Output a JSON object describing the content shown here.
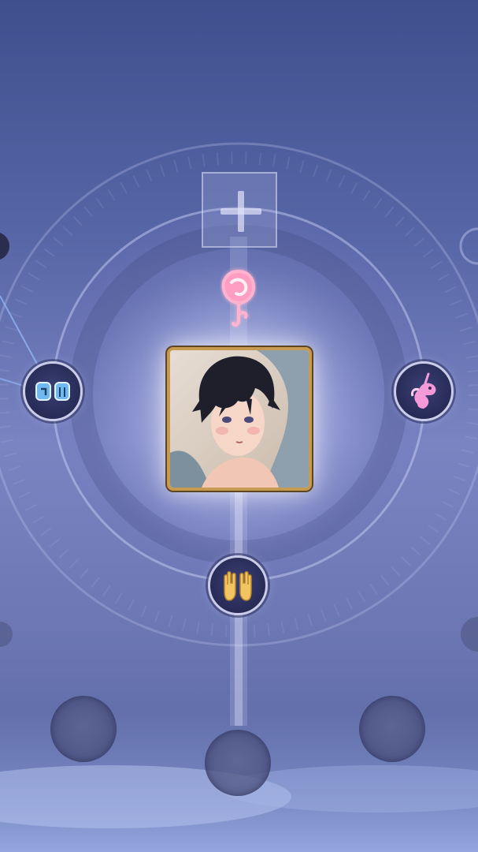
{
  "screen": "relationship-tree",
  "colors": {
    "node_border": "#c9cde8",
    "portrait_frame": "#c79a52",
    "rose": "#ffb3cf",
    "unicorn": "#f59ad8",
    "fist": "#6fb8f0",
    "hands": "#f3c462"
  },
  "center_character": {
    "icon": "character-portrait"
  },
  "nodes": {
    "top": {
      "icon": "rose-icon"
    },
    "left": {
      "icon": "fist-bump-icon"
    },
    "right": {
      "icon": "unicorn-icon"
    },
    "bottom": {
      "icon": "raised-hands-icon"
    }
  },
  "add_slot": {
    "icon": "plus-icon"
  },
  "locked_slots": 5
}
